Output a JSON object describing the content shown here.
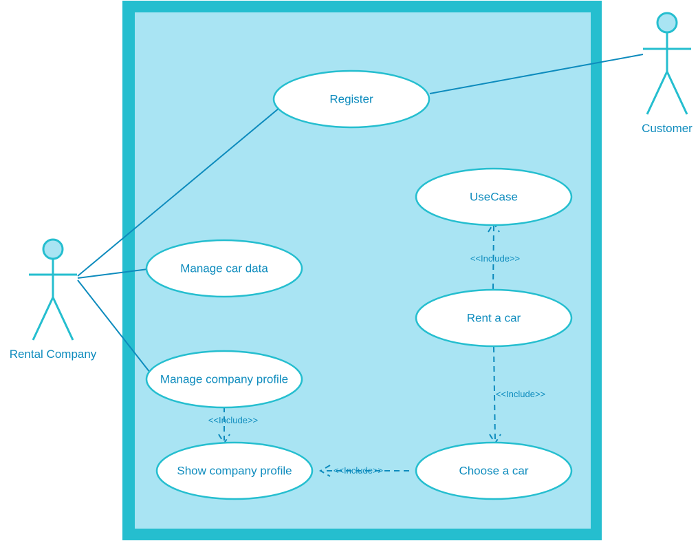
{
  "actors": {
    "rental_company": "Rental Company",
    "customer": "Customer"
  },
  "usecases": {
    "register": "Register",
    "manage_car_data": "Manage car data",
    "manage_company_profile": "Manage company profile",
    "show_company_profile": "Show company profile",
    "usecase": "UseCase",
    "rent_a_car": "Rent a car",
    "choose_a_car": "Choose a car"
  },
  "stereotype": "<<Include>>",
  "colors": {
    "border": "#25becf",
    "fill": "#a9e4f3",
    "text": "#0d8bbd"
  }
}
